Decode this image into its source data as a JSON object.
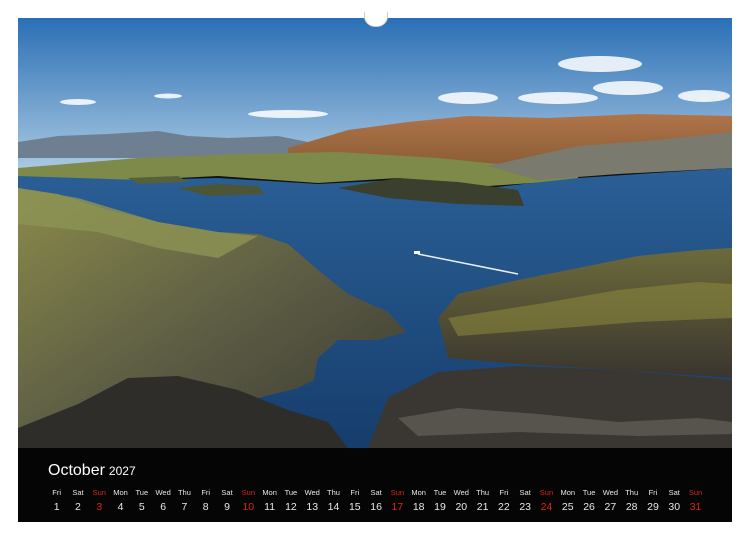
{
  "calendar": {
    "month": "October",
    "year": "2027",
    "days": [
      {
        "dn": "Fri",
        "num": "1"
      },
      {
        "dn": "Sat",
        "num": "2"
      },
      {
        "dn": "Sun",
        "num": "3",
        "sun": true
      },
      {
        "dn": "Mon",
        "num": "4"
      },
      {
        "dn": "Tue",
        "num": "5"
      },
      {
        "dn": "Wed",
        "num": "6"
      },
      {
        "dn": "Thu",
        "num": "7"
      },
      {
        "dn": "Fri",
        "num": "8"
      },
      {
        "dn": "Sat",
        "num": "9"
      },
      {
        "dn": "Sun",
        "num": "10",
        "sun": true
      },
      {
        "dn": "Mon",
        "num": "11"
      },
      {
        "dn": "Tue",
        "num": "12"
      },
      {
        "dn": "Wed",
        "num": "13"
      },
      {
        "dn": "Thu",
        "num": "14"
      },
      {
        "dn": "Fri",
        "num": "15"
      },
      {
        "dn": "Sat",
        "num": "16"
      },
      {
        "dn": "Sun",
        "num": "17",
        "sun": true
      },
      {
        "dn": "Mon",
        "num": "18"
      },
      {
        "dn": "Tue",
        "num": "19"
      },
      {
        "dn": "Wed",
        "num": "20"
      },
      {
        "dn": "Thu",
        "num": "21"
      },
      {
        "dn": "Fri",
        "num": "22"
      },
      {
        "dn": "Sat",
        "num": "23"
      },
      {
        "dn": "Sun",
        "num": "24",
        "sun": true
      },
      {
        "dn": "Mon",
        "num": "25"
      },
      {
        "dn": "Tue",
        "num": "26"
      },
      {
        "dn": "Wed",
        "num": "27"
      },
      {
        "dn": "Thu",
        "num": "28"
      },
      {
        "dn": "Fri",
        "num": "29"
      },
      {
        "dn": "Sat",
        "num": "30"
      },
      {
        "dn": "Sun",
        "num": "31",
        "sun": true
      }
    ]
  },
  "colors": {
    "sunday": "#e2231a",
    "calendar_bg": "#050505",
    "sea": "#1f4f86",
    "sky_top": "#2a6fb5"
  }
}
